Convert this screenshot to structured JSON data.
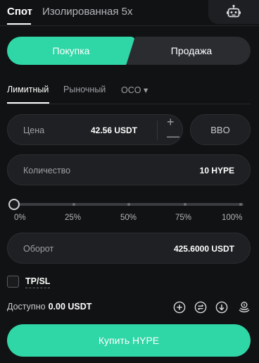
{
  "top_tabs": {
    "spot": "Спот",
    "isolated": "Изолированная 5x"
  },
  "side": {
    "buy": "Покупка",
    "sell": "Продажа"
  },
  "order_types": {
    "limit": "Лимитный",
    "market": "Рыночный",
    "oco": "OCO ▾"
  },
  "price": {
    "label": "Цена",
    "value": "42.56 USDT",
    "plus": "+",
    "minus": "—"
  },
  "bbo_label": "BBO",
  "quantity": {
    "label": "Количество",
    "value": "10 HYPE"
  },
  "slider": {
    "labels": [
      "0%",
      "25%",
      "50%",
      "75%",
      "100%"
    ],
    "value_percent": 0
  },
  "turnover": {
    "label": "Оборот",
    "value": "425.6000 USDT"
  },
  "tpsl_label": "TP/SL",
  "available": {
    "label": "Доступно",
    "value": "0.00 USDT"
  },
  "submit_label": "Купить HYPE",
  "icons": [
    "robot-icon",
    "add-circle-icon",
    "transfer-icon",
    "download-icon",
    "coins-icon"
  ],
  "colors": {
    "accent": "#2fd6a6",
    "background": "#111213",
    "field": "#1e2023"
  }
}
